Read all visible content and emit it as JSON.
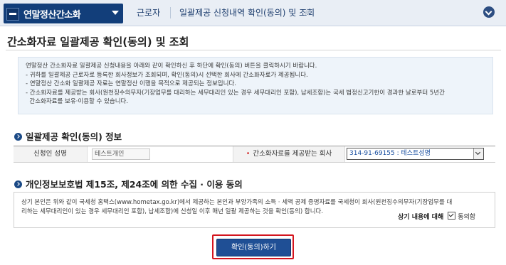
{
  "header": {
    "menu_title": "연말정산간소화",
    "breadcrumbs": [
      "근로자",
      "일괄제공 신청내역 확인(동의) 및 조회"
    ],
    "star": "★"
  },
  "page": {
    "title": "간소화자료 일괄제공 확인(동의) 및 조회"
  },
  "notice": {
    "lines": [
      "연말정산 간소화자료 일괄제공 신청내용을 아래와 같이 확인하신 후 하단에 확인(동의) 버튼을 클릭하시기 바랍니다.",
      "- 귀하를 일괄제공 근로자로 등록한 회사정보가 조회되며, 확인(동의)시 선택한 회사에 간소화자료가 제공됩니다.",
      "- 연말정산 간소화 일괄제공 자료는 연말정산 이행을 목적으로 제공되는 정보입니다.",
      "- 간소화자료를 제공받는 회사(원천징수의무자(기장업무를 대리하는 세무대리인 있는 경우 세무대리인 포함), 납세조합)는 국세 법정신고기한이 경과한 날로부터 5년간",
      "  간소화자료를 보유·이용할 수 있습니다."
    ]
  },
  "section1": {
    "title": "일괄제공 확인(동의) 정보",
    "applicant_label": "신청인 성명",
    "applicant_value": "테스트개인",
    "required_mark": "•",
    "company_label": "간소화자료를 제공받는 회사",
    "company_value": "314-91-69155 : 테스트성명"
  },
  "section2": {
    "title": "개인정보보호법 제15조, 제24조에 의한 수집 · 이용 동의",
    "consent_lines": [
      "상기 본인은 위와 같이 국세청 홈택스(www.hometax.go.kr)에서 제공하는 본인과 부양가족의 소득 · 세액 공제 증명자료를 국세청이 회사(원천징수의무자(기장업무를 대",
      "리하는 세무대리인이 있는 경우 세무대리인 포함), 납세조합)에 신청일 이후 매년 일괄 제공하는 것을 확인(동의) 합니다."
    ],
    "agree_label": "상기 내용에 대해",
    "agree_checkbox_label": "동의함",
    "agree_checked": true
  },
  "actions": {
    "confirm_label": "확인(동의)하기"
  },
  "colors": {
    "header_menu": "#123e7a",
    "button": "#1f4f95",
    "highlight": "#d4151e",
    "notice_bg": "#eef4fa"
  }
}
